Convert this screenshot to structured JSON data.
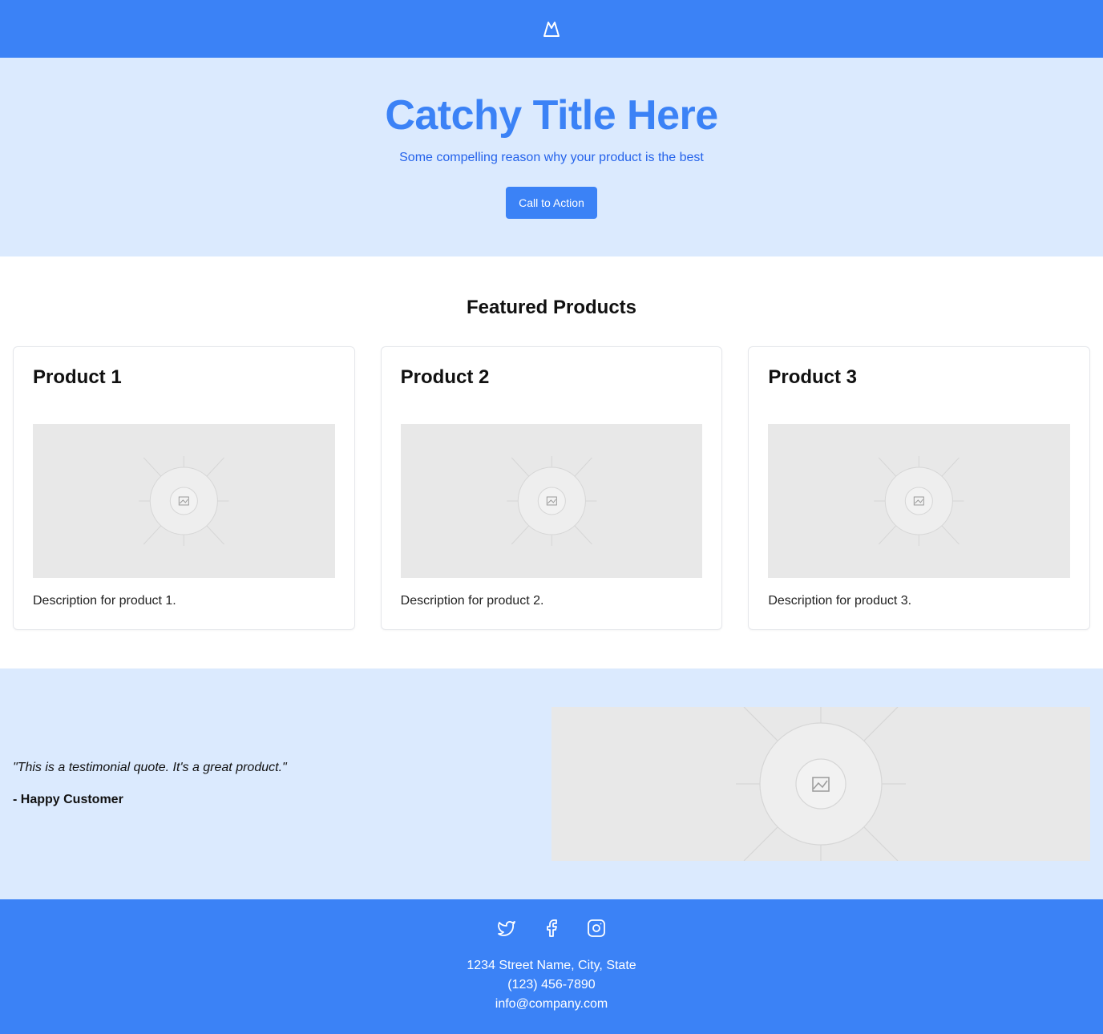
{
  "header": {
    "logo_icon": "mountain-logo-icon"
  },
  "hero": {
    "title": "Catchy Title Here",
    "subtitle": "Some compelling reason why your product is the best",
    "cta_label": "Call to Action"
  },
  "products": {
    "heading": "Featured Products",
    "items": [
      {
        "title": "Product 1",
        "description": "Description for product 1.",
        "image_icon": "image-placeholder-icon"
      },
      {
        "title": "Product 2",
        "description": "Description for product 2.",
        "image_icon": "image-placeholder-icon"
      },
      {
        "title": "Product 3",
        "description": "Description for product 3.",
        "image_icon": "image-placeholder-icon"
      }
    ]
  },
  "testimonial": {
    "quote": "\"This is a testimonial quote. It's a great product.\"",
    "author": "- Happy Customer",
    "image_icon": "image-placeholder-icon"
  },
  "footer": {
    "socials": [
      "twitter-icon",
      "facebook-icon",
      "instagram-icon"
    ],
    "address": "1234 Street Name, City, State",
    "phone": "(123) 456-7890",
    "email": "info@company.com"
  },
  "colors": {
    "primary": "#3b82f6",
    "hero_background": "#dbeafe",
    "placeholder": "#e8e8e8"
  }
}
